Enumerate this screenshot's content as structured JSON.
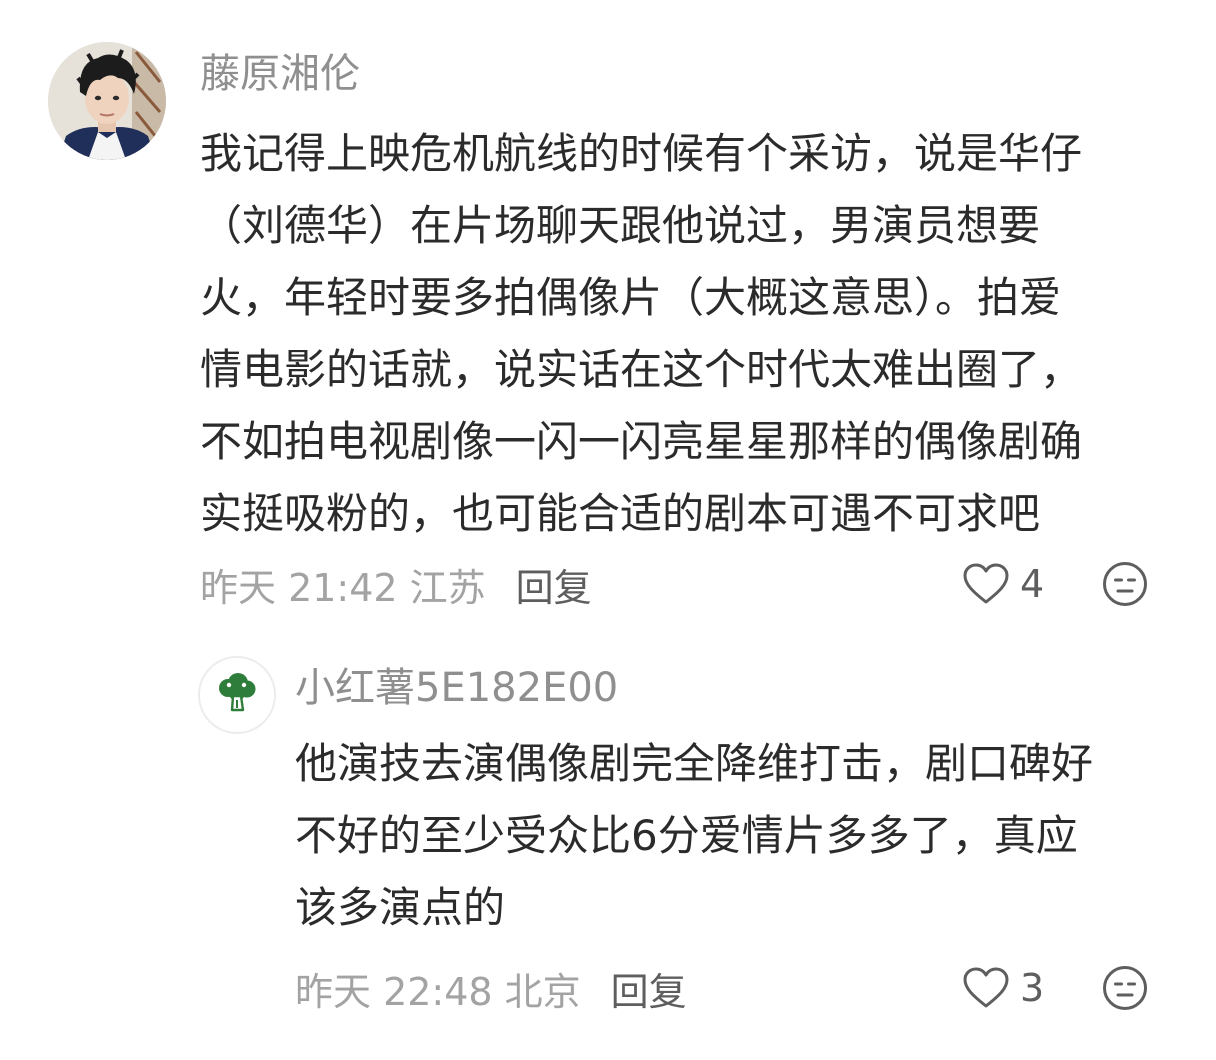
{
  "comment": {
    "author": "藤原湘伦",
    "text": "我记得上映危机航线的时候有个采访，说是华仔\n（刘德华）在片场聊天跟他说过，男演员想要\n火，年轻时要多拍偶像片（大概这意思）。拍爱\n情电影的话就，说实话在这个时代太难出圈了，\n不如拍电视剧像一闪一闪亮星星那样的偶像剧确\n实挺吸粉的，也可能合适的剧本可遇不可求吧",
    "time_location": "昨天 21:42 江苏",
    "reply_label": "回复",
    "like_count": "4",
    "like_icon": "heart-outline-icon",
    "reaction_icon": "neutral-face-icon"
  },
  "reply": {
    "author": "小红薯5E182E00",
    "text": "他演技去演偶像剧完全降维打击，剧口碑好\n不好的至少受众比6分爱情片多多了，真应\n该多演点的",
    "time_location": "昨天 22:48 北京",
    "reply_label": "回复",
    "like_count": "3",
    "like_icon": "heart-outline-icon",
    "reaction_icon": "neutral-face-icon",
    "avatar_icon": "broccoli-icon"
  },
  "colors": {
    "name": "#8f8f8f",
    "meta": "#a3a3a3",
    "action": "#5e5e5e",
    "body": "#2b2b2b",
    "broccoli": "#2f7d3a"
  }
}
